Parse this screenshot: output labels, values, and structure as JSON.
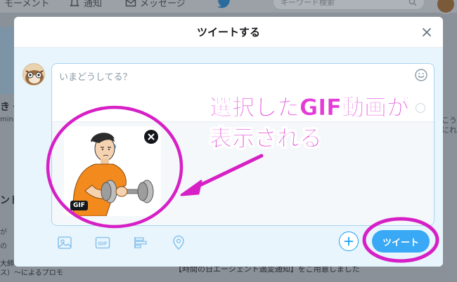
{
  "background": {
    "nav_moments": "モーメント",
    "nav_notifications": "通知",
    "nav_messages": "メッセージ",
    "search_placeholder": "キーワード検索",
    "left_heading": "き・",
    "left_small": "mini",
    "left_heading2": "ンド",
    "left_small2": "が",
    "left_small3": "の",
    "right_text": "こうにれ",
    "bottom_text": "【時間の日エージェント過変通知】をご用意しました",
    "bottom_left": "大師 〜元と隣の文戦（ひ クロス）〜によるプロモ"
  },
  "modal": {
    "title": "ツイートする",
    "placeholder": "いまどうしてる？",
    "gif_badge": "GIF",
    "tweet_button": "ツイート"
  },
  "annotation": {
    "line1": "選択したGIF動画が",
    "line2": "表示される",
    "color": "#e33bd6"
  },
  "colors": {
    "accent": "#1da1f2",
    "tweet_button": "#39a9f5",
    "annotation": "#e33bd6"
  },
  "icons": [
    "bell-icon",
    "envelope-icon",
    "twitter-bird-icon",
    "search-icon",
    "close-icon",
    "emoji-icon",
    "remove-media-icon",
    "image-icon",
    "gif-icon",
    "poll-icon",
    "location-icon",
    "plus-icon"
  ]
}
